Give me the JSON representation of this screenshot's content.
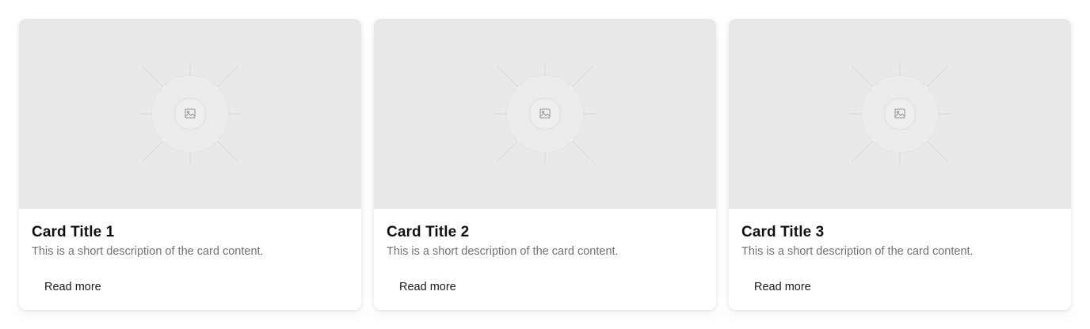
{
  "cards": [
    {
      "title": "Card Title 1",
      "description": "This is a short description of the card content.",
      "button_label": "Read more",
      "image_icon": "image-placeholder-icon"
    },
    {
      "title": "Card Title 2",
      "description": "This is a short description of the card content.",
      "button_label": "Read more",
      "image_icon": "image-placeholder-icon"
    },
    {
      "title": "Card Title 3",
      "description": "This is a short description of the card content.",
      "button_label": "Read more",
      "image_icon": "image-placeholder-icon"
    }
  ],
  "colors": {
    "placeholder_bg": "#e9e9e9",
    "title": "#111111",
    "description": "#6b7280",
    "button_text": "#1a1a1a"
  }
}
